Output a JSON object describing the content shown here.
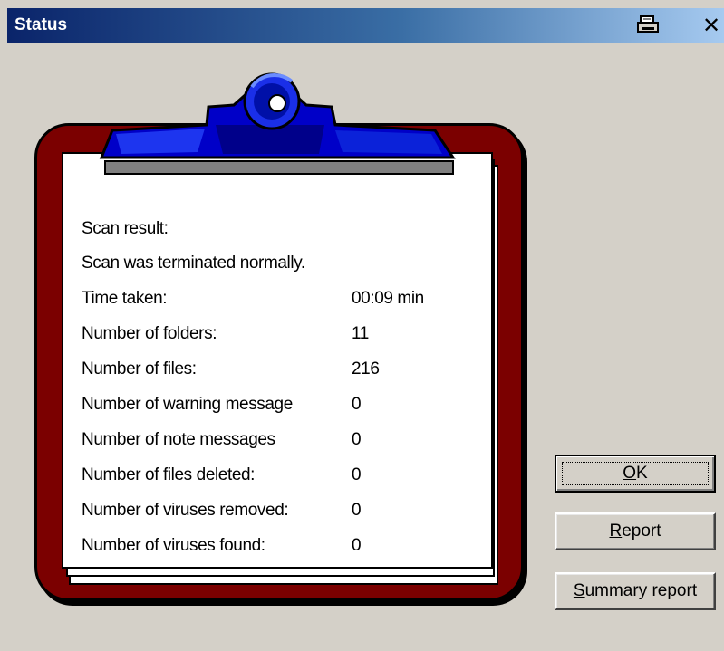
{
  "window": {
    "title": "Status",
    "print_icon": "printer-icon",
    "close_glyph": "✕",
    "close_icon": "close-icon"
  },
  "scan": {
    "rows": [
      {
        "label": "Scan result:",
        "value": ""
      },
      {
        "label": "Scan was terminated normally.",
        "value": ""
      },
      {
        "label": "Time taken:",
        "value": "00:09 min"
      },
      {
        "label": "Number of folders:",
        "value": "11"
      },
      {
        "label": "Number of files:",
        "value": "216"
      },
      {
        "label": "Number of warning message",
        "value": "0"
      },
      {
        "label": "Number of note messages",
        "value": "0"
      },
      {
        "label": "Number of files deleted:",
        "value": "0"
      },
      {
        "label": "Number of viruses removed:",
        "value": "0"
      },
      {
        "label": "Number of viruses found:",
        "value": "0"
      }
    ]
  },
  "buttons": {
    "ok": {
      "accel": "O",
      "rest": "K"
    },
    "report": {
      "accel": "R",
      "rest": "eport"
    },
    "summary": {
      "accel": "S",
      "rest": "ummary report"
    }
  },
  "colors": {
    "board": "#7b0000",
    "clip": "#0000c8",
    "title_start": "#0a246a",
    "title_end": "#a6caf0",
    "face": "#d4d0c8"
  }
}
